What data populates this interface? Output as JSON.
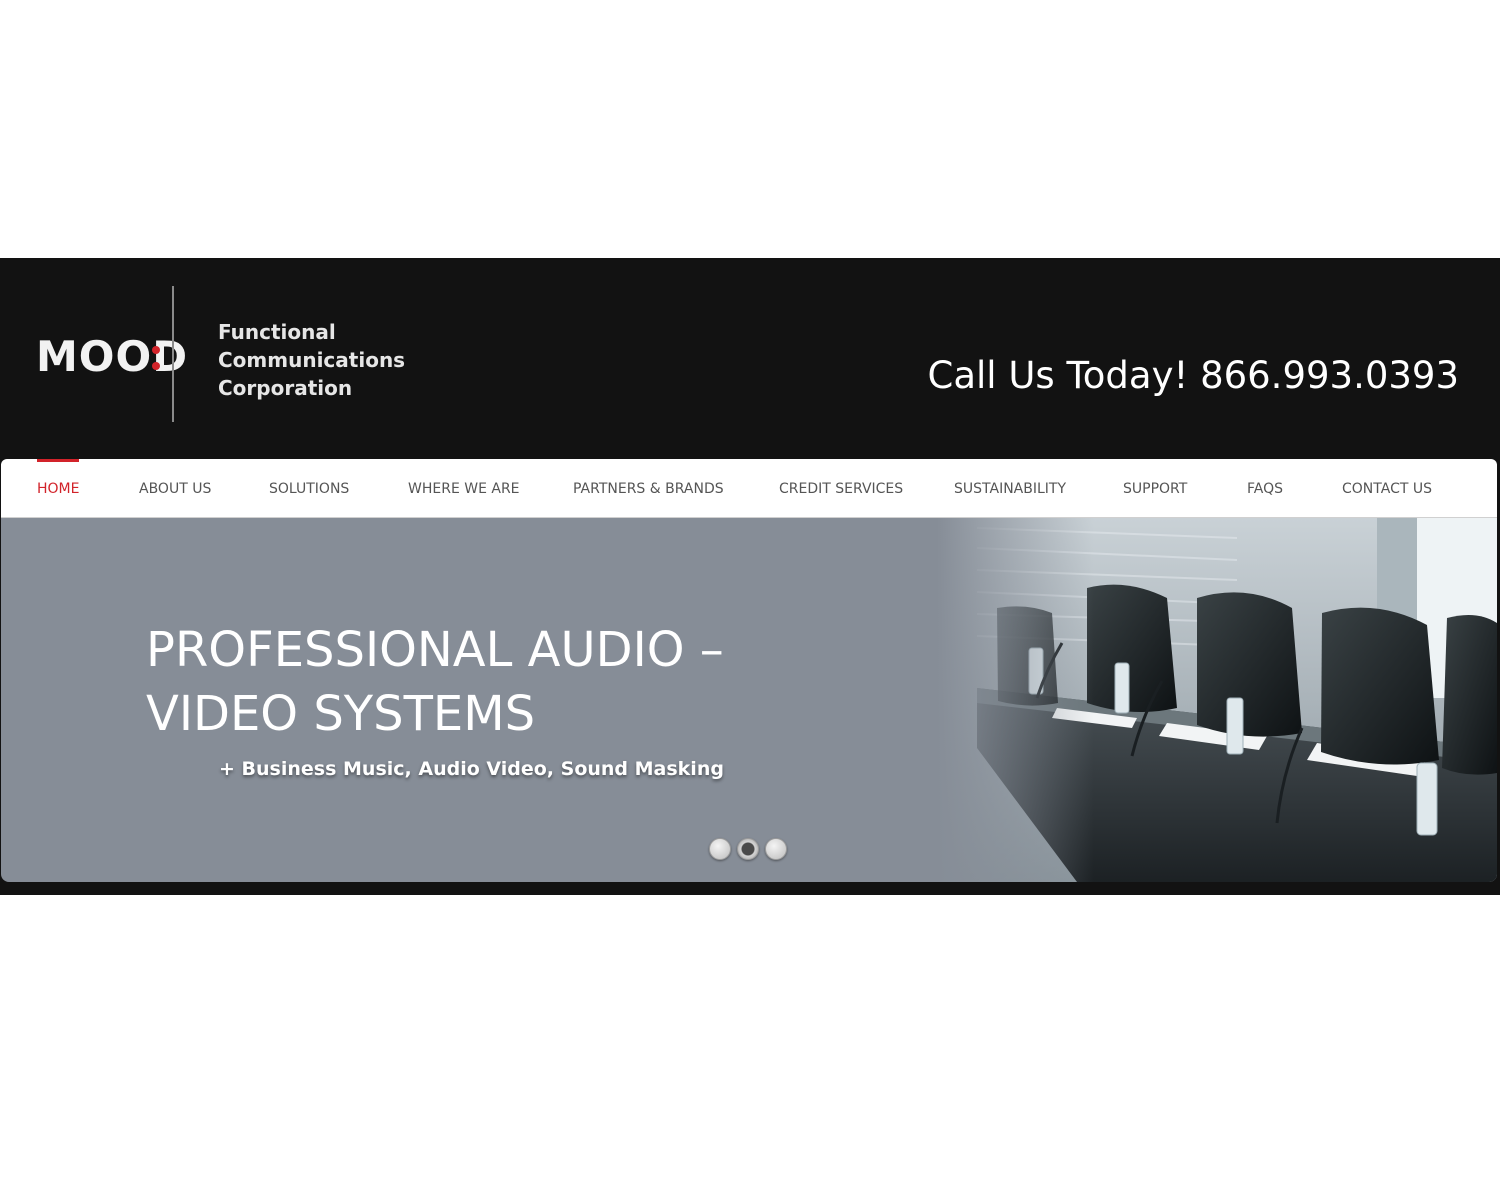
{
  "header": {
    "logo_word": "MOOD",
    "logo_tagline": [
      "Functional",
      "Communications",
      "Corporation"
    ],
    "phone_text": "Call Us Today! 866.993.0393"
  },
  "nav": {
    "items": [
      {
        "label": "HOME",
        "active": true
      },
      {
        "label": "ABOUT US",
        "active": false
      },
      {
        "label": "SOLUTIONS",
        "active": false
      },
      {
        "label": "WHERE WE ARE",
        "active": false
      },
      {
        "label": "PARTNERS & BRANDS",
        "active": false
      },
      {
        "label": "CREDIT SERVICES",
        "active": false
      },
      {
        "label": "SUSTAINABILITY",
        "active": false
      },
      {
        "label": "SUPPORT",
        "active": false
      },
      {
        "label": "FAQS",
        "active": false
      },
      {
        "label": "CONTACT US",
        "active": false
      }
    ]
  },
  "hero": {
    "title_line1": "PROFESSIONAL AUDIO –",
    "title_line2": "VIDEO SYSTEMS",
    "subtitle": "+ Business Music, Audio Video, Sound Masking",
    "image": "conference-room-photo",
    "slides": 3,
    "active_slide": 2
  },
  "colors": {
    "accent": "#d2232a",
    "header_bg": "#121212",
    "hero_bg": "#868d97",
    "nav_text": "#555555"
  }
}
